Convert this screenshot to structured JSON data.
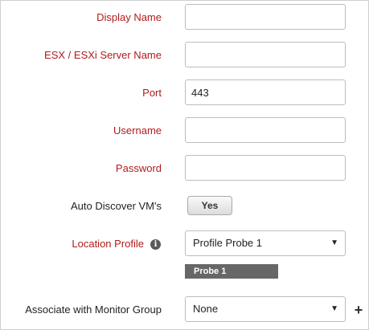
{
  "form": {
    "display_name": {
      "label": "Display Name",
      "value": ""
    },
    "server_name": {
      "label": "ESX / ESXi Server Name",
      "value": ""
    },
    "port": {
      "label": "Port",
      "value": "443"
    },
    "username": {
      "label": "Username",
      "value": ""
    },
    "password": {
      "label": "Password",
      "value": ""
    },
    "auto_discover": {
      "label": "Auto Discover VM's",
      "button_label": "Yes"
    },
    "location_profile": {
      "label": "Location Profile",
      "selected": "Profile Probe 1",
      "info_icon": "i",
      "selected_tag": "Probe 1"
    },
    "monitor_group": {
      "label": "Associate with Monitor Group",
      "selected": "None",
      "add_icon": "+"
    }
  },
  "colors": {
    "required_label": "#b01c1c",
    "tag_background": "#676767"
  },
  "icons": {
    "info": "info-icon",
    "dropdown": "chevron-down-icon",
    "add": "plus-icon"
  }
}
